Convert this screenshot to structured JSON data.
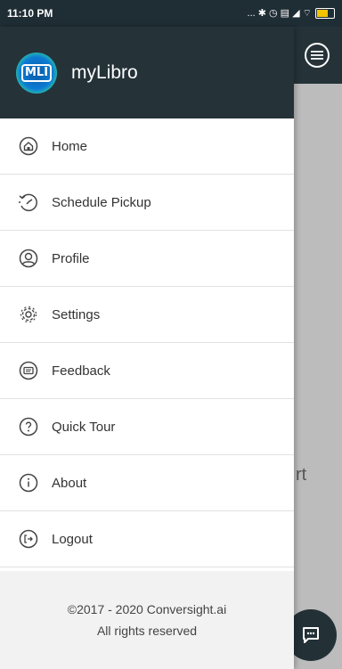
{
  "status_bar": {
    "time": "11:10 PM",
    "indicators": "... ✱ ◷ ▤ ◢ ⌔"
  },
  "background": {
    "partial_text": "rt"
  },
  "drawer": {
    "app_name": "myLibro",
    "logo_text": "MLI",
    "menu": [
      {
        "label": "Home",
        "icon": "home-icon"
      },
      {
        "label": "Schedule Pickup",
        "icon": "schedule-icon"
      },
      {
        "label": "Profile",
        "icon": "profile-icon"
      },
      {
        "label": "Settings",
        "icon": "settings-icon"
      },
      {
        "label": "Feedback",
        "icon": "feedback-icon"
      },
      {
        "label": "Quick Tour",
        "icon": "help-icon"
      },
      {
        "label": "About",
        "icon": "info-icon"
      },
      {
        "label": "Logout",
        "icon": "logout-icon"
      }
    ],
    "footer": {
      "copyright": "©2017 - 2020 Conversight.ai",
      "rights": "All rights reserved"
    }
  },
  "colors": {
    "header": "#253339",
    "drawer_bg": "#ffffff",
    "footer_bg": "#f2f2f2",
    "overlay": "#bcbcbc"
  }
}
